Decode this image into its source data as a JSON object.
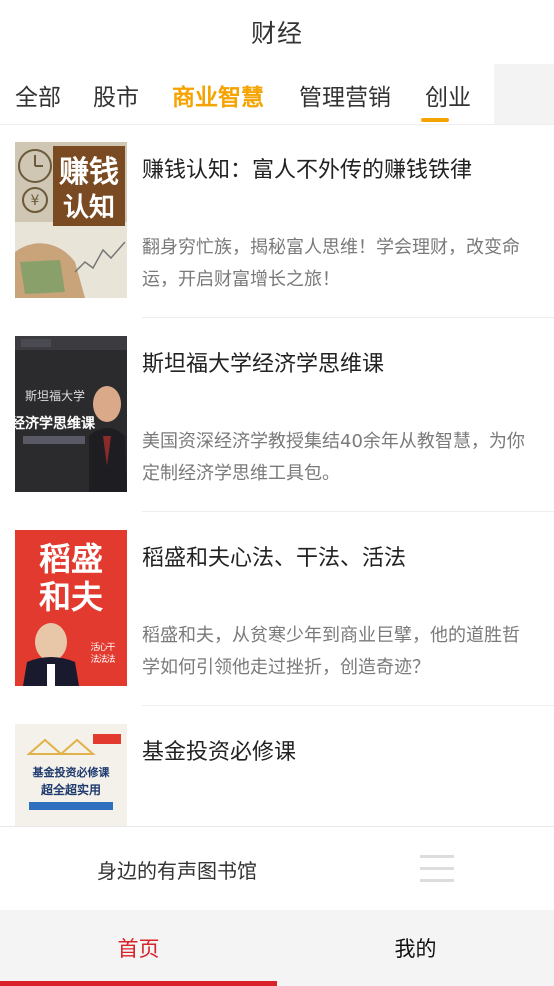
{
  "header": {
    "title": "财经"
  },
  "tabs": [
    {
      "label": "全部"
    },
    {
      "label": "股市"
    },
    {
      "label": "商业智慧"
    },
    {
      "label": "管理营销"
    },
    {
      "label": "创业"
    }
  ],
  "items": [
    {
      "title": "赚钱认知：富人不外传的赚钱铁律",
      "desc": "翻身穷忙族，揭秘富人思维！学会理财，改变命运，开启财富增长之旅！",
      "cover": {
        "line1": "赚钱",
        "line2": "认知",
        "symbol": "¥"
      }
    },
    {
      "title": "斯坦福大学经济学思维课",
      "desc": "美国资深经济学教授集结40余年从教智慧，为你定制经济学思维工具包。",
      "cover": {
        "line1": "斯坦福大学",
        "line2": "经济学思维课"
      }
    },
    {
      "title": "稻盛和夫心法、干法、活法",
      "desc": "稻盛和夫，从贫寒少年到商业巨擘，他的道胜哲学如何引领他走过挫折，创造奇迹？",
      "cover": {
        "line1": "稻盛",
        "line2": "和夫",
        "tags": [
          "活",
          "心",
          "干",
          "法",
          "法",
          "法"
        ]
      }
    },
    {
      "title": "基金投资必修课",
      "desc": "",
      "cover": {
        "line1": "基金投资必修课",
        "line2": "超全超实用"
      }
    }
  ],
  "library": {
    "label": "身边的有声图书馆"
  },
  "bottom_nav": {
    "home": "首页",
    "mine": "我的"
  },
  "colors": {
    "accent_tab": "#f5a300",
    "nav_active": "#d8232a"
  }
}
